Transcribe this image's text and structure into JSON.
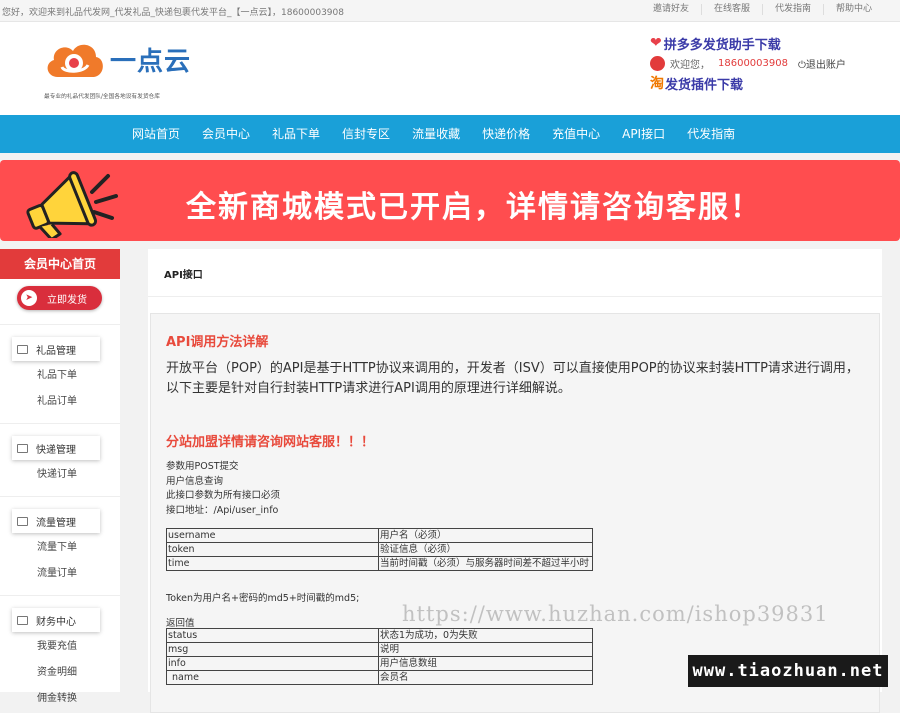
{
  "topbar": {
    "welcome": "您好，欢迎来到礼品代发网_代发礼品_快递包裹代发平台_【一点云】，18600003908",
    "links": [
      "邀请好友",
      "在线客服",
      "代发指南",
      "帮助中心"
    ]
  },
  "header": {
    "brand": "一点云",
    "slogan": "最专业的礼品代发团队/全国各地设有发货仓库",
    "pdd_download": "拼多多发货助手下载",
    "welcome": "欢迎您，",
    "phone": "18600003908",
    "logout": "退出账户",
    "tao_plugin": "发货插件下载",
    "tao_char": "淘"
  },
  "nav": [
    "网站首页",
    "会员中心",
    "礼品下单",
    "信封专区",
    "流量收藏",
    "快递价格",
    "充值中心",
    "API接口",
    "代发指南"
  ],
  "banner": {
    "text": "全新商城模式已开启，详情请咨询客服！"
  },
  "sidebar": {
    "head": "会员中心首页",
    "ship": "立即发货",
    "groups": [
      {
        "title": "礼品管理",
        "items": [
          "礼品下单",
          "礼品订单"
        ]
      },
      {
        "title": "快递管理",
        "items": [
          "快递订单"
        ]
      },
      {
        "title": "流量管理",
        "items": [
          "流量下单",
          "流量订单"
        ]
      },
      {
        "title": "财务中心",
        "items": [
          "我要充值",
          "资金明细",
          "佣金转换"
        ]
      }
    ]
  },
  "main": {
    "crumb": "API接口",
    "h1": "API调用方法详解",
    "intro": "开放平台（POP）的API是基于HTTP协议来调用的，开发者（ISV）可以直接使用POP的协议来封装HTTP请求进行调用，以下主要是针对自行封装HTTP请求进行API调用的原理进行详细解说。",
    "h2": "分站加盟详情请咨询网站客服！！！",
    "lines": [
      "参数用POST提交",
      "用户信息查询",
      "此接口参数为所有接口必须",
      "接口地址：/Api/user_info"
    ],
    "params": [
      {
        "k": "username",
        "v": "用户名（必须）"
      },
      {
        "k": "token",
        "v": "验证信息（必须）"
      },
      {
        "k": "time",
        "v": "当前时间戳（必须）与服务器时间差不超过半小时"
      }
    ],
    "note": "Token为用户名+密码的md5+时间戳的md5;",
    "ret_label": "返回值",
    "returns": [
      {
        "k": "status",
        "v": "状态1为成功，0为失败"
      },
      {
        "k": "msg",
        "v": "说明"
      },
      {
        "k": "info",
        "v": "用户信息数组"
      },
      {
        "k": " name",
        "v": "会员名"
      }
    ]
  },
  "watermarks": {
    "huzhan": "https://www.huzhan.com/ishop39831",
    "tiaozhuan": "www.tiaozhuan.net"
  }
}
